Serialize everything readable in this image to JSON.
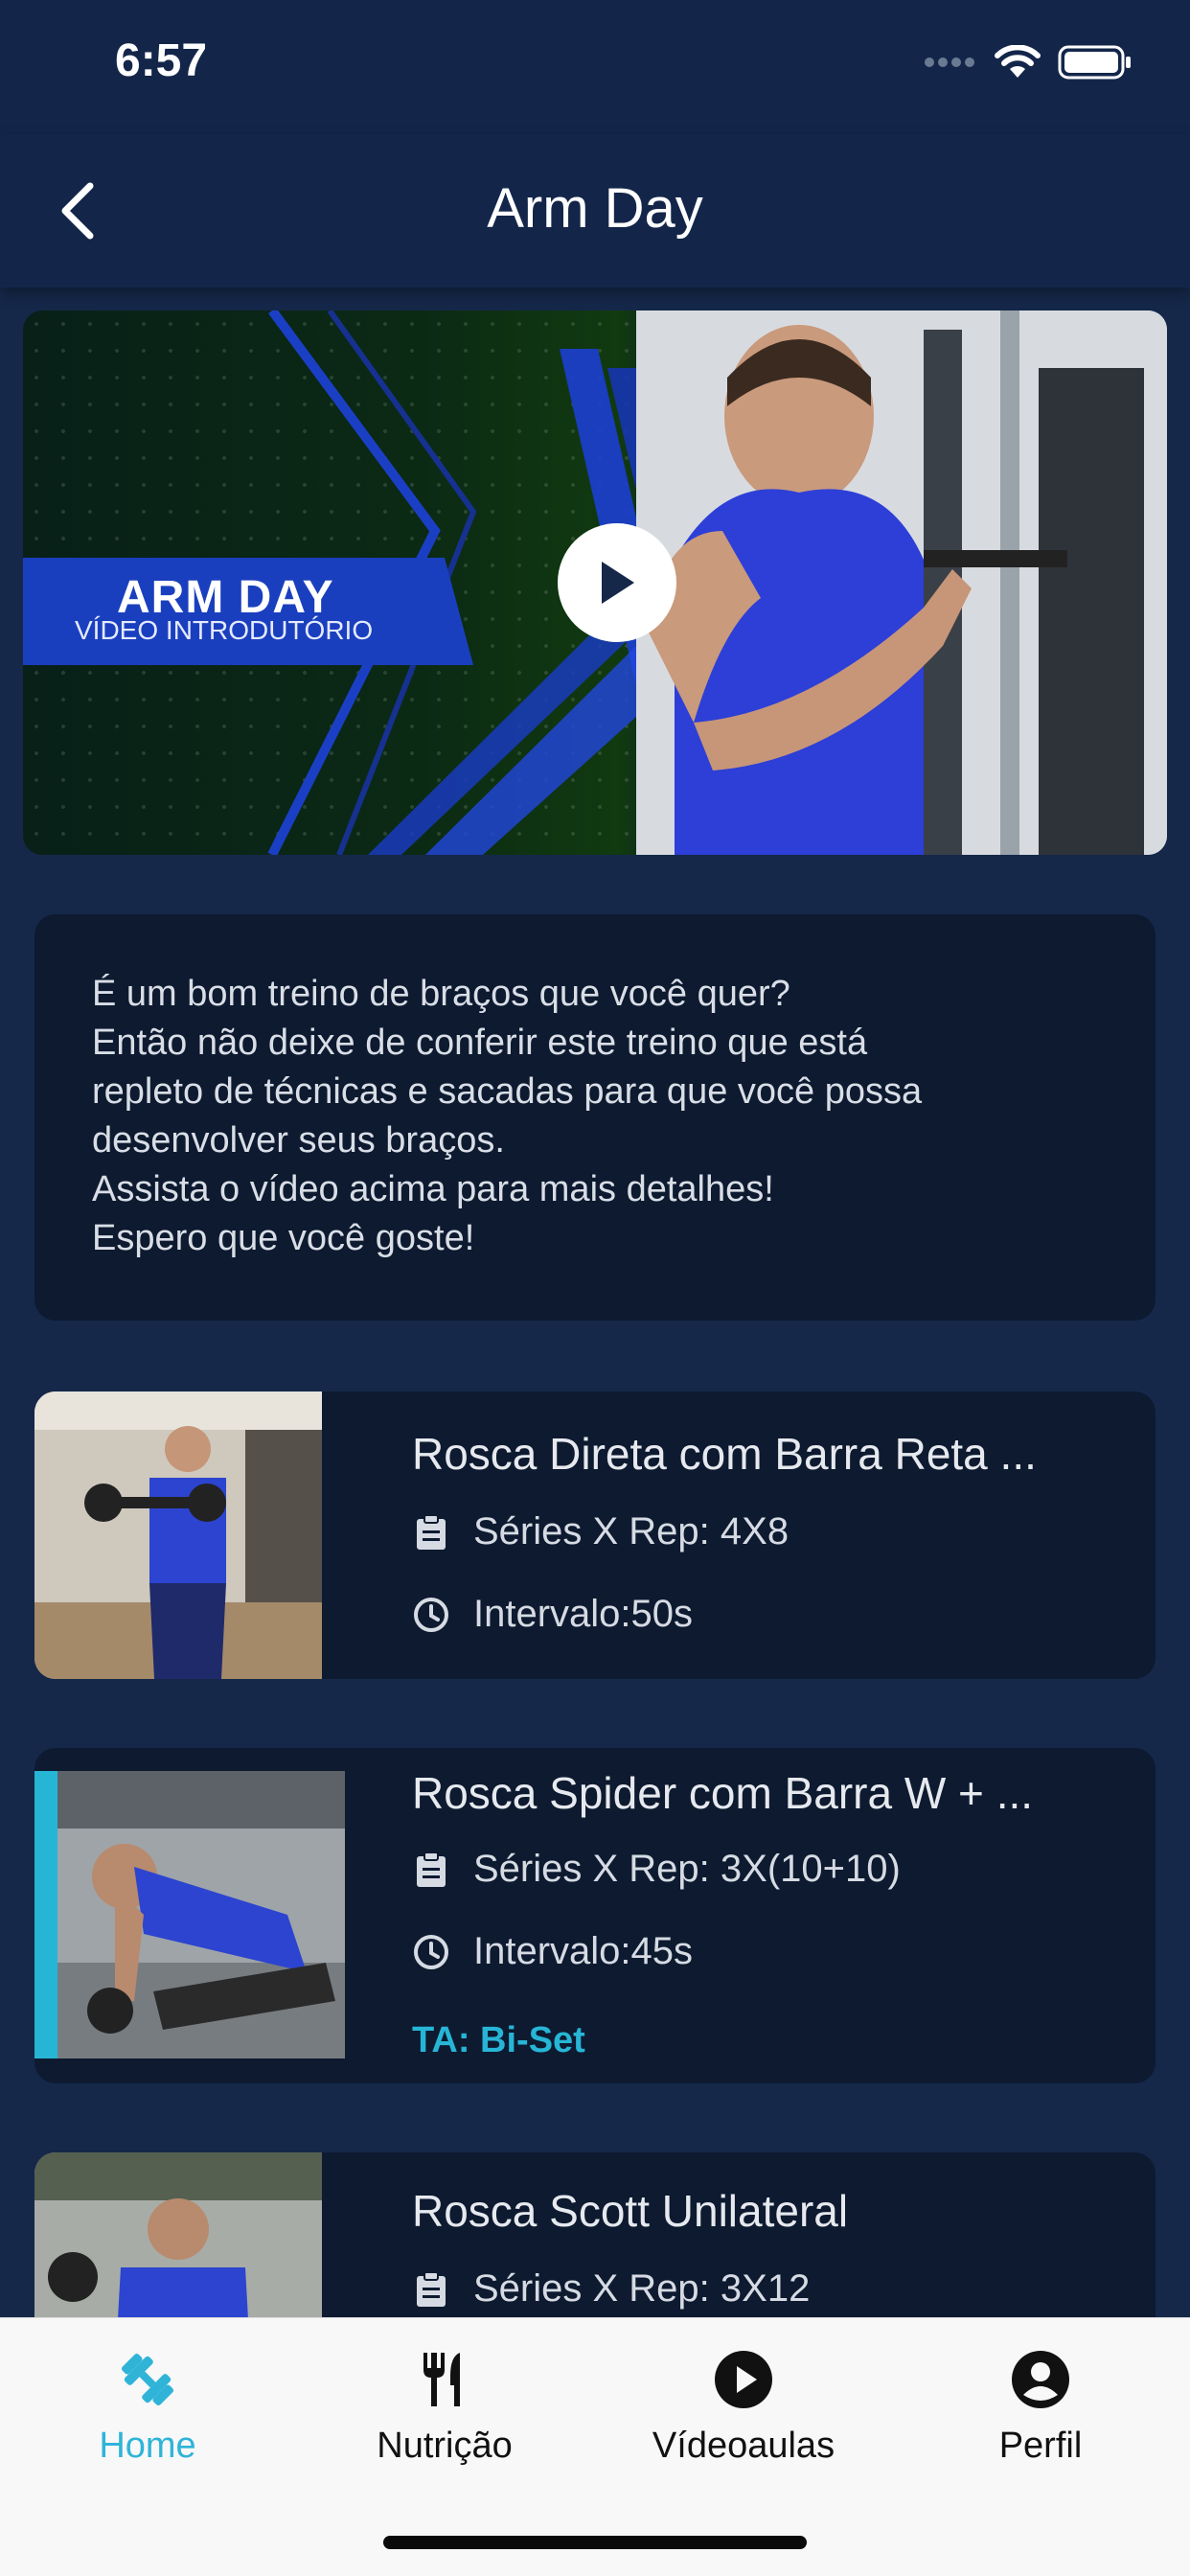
{
  "status_bar": {
    "time": "6:57"
  },
  "header": {
    "title": "Arm Day"
  },
  "video": {
    "banner_title": "ARM DAY",
    "banner_subtitle": "VÍDEO INTRODUTÓRIO"
  },
  "description": {
    "lines": [
      "É um bom treino de braços que você quer?",
      "Então não deixe de conferir este treino que está",
      "repleto de técnicas e sacadas para que você possa",
      "desenvolver seus braços.",
      "Assista o vídeo acima para mais detalhes!",
      "Espero que você goste!"
    ]
  },
  "exercises": [
    {
      "title": "Rosca Direta com Barra Reta ...",
      "sets": "Séries X Rep: 4X8",
      "interval": "Intervalo:50s",
      "technique": ""
    },
    {
      "title": "Rosca Spider com Barra W + ...",
      "sets": "Séries X Rep: 3X(10+10)",
      "interval": "Intervalo:45s",
      "technique": "TA: Bi-Set"
    },
    {
      "title": "Rosca Scott Unilateral",
      "sets": "Séries X Rep: 3X12",
      "interval": "",
      "technique": ""
    }
  ],
  "bottom_nav": {
    "items": [
      {
        "label": "Home",
        "icon": "dumbbell-icon",
        "active": true
      },
      {
        "label": "Nutrição",
        "icon": "fork-knife-icon",
        "active": false
      },
      {
        "label": "Vídeoaulas",
        "icon": "play-circle-icon",
        "active": false
      },
      {
        "label": "Perfil",
        "icon": "person-circle-icon",
        "active": false
      }
    ]
  },
  "colors": {
    "background": "#15284a",
    "card": "#0d1a30",
    "accent": "#27b5d6",
    "banner_blue": "#1a3fbe"
  }
}
